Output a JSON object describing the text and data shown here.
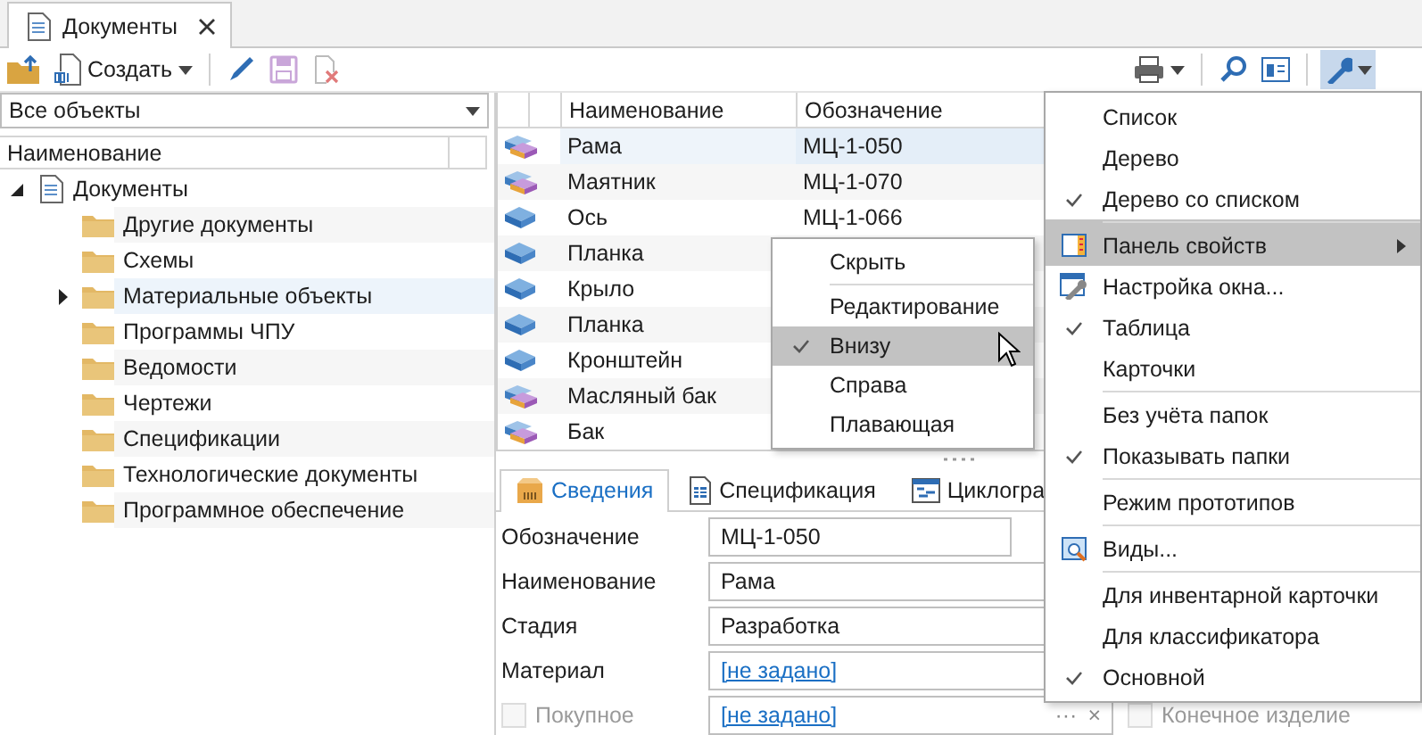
{
  "document_tab": {
    "title": "Документы",
    "selected": true
  },
  "toolbar": {
    "create_label": "Создать",
    "wrench_pressed": true
  },
  "filter": {
    "value": "Все объекты"
  },
  "tree": {
    "column": "Наименование",
    "items": [
      {
        "label": "Документы",
        "kind": "document",
        "expanded": true,
        "hovered": false,
        "children": [
          {
            "label": "Другие документы",
            "kind": "folder",
            "has_children": false,
            "hovered": false
          },
          {
            "label": "Схемы",
            "kind": "folder",
            "has_children": false,
            "hovered": false
          },
          {
            "label": "Материальные объекты",
            "kind": "folder",
            "has_children": true,
            "hovered": true
          },
          {
            "label": "Программы ЧПУ",
            "kind": "folder",
            "has_children": false,
            "hovered": false
          },
          {
            "label": "Ведомости",
            "kind": "folder",
            "has_children": false,
            "hovered": false
          },
          {
            "label": "Чертежи",
            "kind": "folder",
            "has_children": false,
            "hovered": false
          },
          {
            "label": "Спецификации",
            "kind": "folder",
            "has_children": false,
            "hovered": false
          },
          {
            "label": "Технологические документы",
            "kind": "folder",
            "has_children": false,
            "hovered": false
          },
          {
            "label": "Программное обеспечение",
            "kind": "folder",
            "has_children": false,
            "hovered": false
          }
        ]
      }
    ]
  },
  "table": {
    "columns": [
      "Наименование",
      "Обозначение"
    ],
    "rows": [
      {
        "kind": "assembly",
        "name": "Рама",
        "code": "МЦ-1-050",
        "selected": true
      },
      {
        "kind": "assembly",
        "name": "Маятник",
        "code": "МЦ-1-070",
        "selected": false
      },
      {
        "kind": "part",
        "name": "Ось",
        "code": "МЦ-1-066",
        "selected": false
      },
      {
        "kind": "part",
        "name": "Планка",
        "selected": false
      },
      {
        "kind": "part",
        "name": "Крыло",
        "selected": false
      },
      {
        "kind": "part",
        "name": "Планка",
        "selected": false
      },
      {
        "kind": "part",
        "name": "Кронштейн",
        "selected": false
      },
      {
        "kind": "assembly",
        "name": "Масляный бак",
        "selected": false
      },
      {
        "kind": "assembly",
        "name": "Бак",
        "selected": false
      }
    ]
  },
  "details": {
    "tabs": [
      {
        "label": "Сведения",
        "kind": "box",
        "selected": true
      },
      {
        "label": "Спецификация",
        "kind": "sheet",
        "selected": false
      },
      {
        "label": "Циклогра",
        "kind": "chart",
        "selected": false
      }
    ],
    "fields": [
      {
        "kind": "text",
        "label": "Обозначение",
        "value": "МЦ-1-050"
      },
      {
        "kind": "text",
        "label": "Наименование",
        "value": "Рама"
      },
      {
        "kind": "text",
        "label": "Стадия",
        "value": "Разработка"
      },
      {
        "kind": "link",
        "label": "Материал",
        "value": "[не задано]"
      },
      {
        "kind": "checkbox",
        "label": "Покупное",
        "checked": false,
        "disabled": true,
        "value": "[не задано]",
        "ellipsis": "···",
        "clear": "×",
        "extra": {
          "label": "Конечное изделие",
          "checked": false,
          "disabled": true
        }
      }
    ]
  },
  "view_menu": {
    "items": [
      {
        "label": "Список",
        "checked": false,
        "highlighted": false,
        "submenu": false,
        "separator_before": false
      },
      {
        "label": "Дерево",
        "checked": false,
        "highlighted": false,
        "submenu": false,
        "separator_before": false
      },
      {
        "label": "Дерево со списком",
        "checked": true,
        "highlighted": false,
        "submenu": false,
        "separator_before": false
      },
      {
        "label": "Панель свойств",
        "kind": "panel",
        "checked": false,
        "highlighted": true,
        "submenu": true,
        "separator_before": true
      },
      {
        "label": "Настройка окна...",
        "kind": "settings",
        "checked": false,
        "highlighted": false,
        "submenu": false,
        "separator_before": false
      },
      {
        "label": "Таблица",
        "checked": true,
        "highlighted": false,
        "submenu": false,
        "separator_before": false
      },
      {
        "label": "Карточки",
        "checked": false,
        "highlighted": false,
        "submenu": false,
        "separator_before": false
      },
      {
        "label": "Без учёта папок",
        "checked": false,
        "highlighted": false,
        "submenu": false,
        "separator_before": true
      },
      {
        "label": "Показывать папки",
        "checked": true,
        "highlighted": false,
        "submenu": false,
        "separator_before": false
      },
      {
        "label": "Режим прототипов",
        "checked": false,
        "highlighted": false,
        "submenu": false,
        "separator_before": true
      },
      {
        "label": "Виды...",
        "kind": "views",
        "checked": false,
        "highlighted": false,
        "submenu": false,
        "separator_before": true
      },
      {
        "label": "Для инвентарной карточки",
        "checked": false,
        "highlighted": false,
        "submenu": false,
        "separator_before": true
      },
      {
        "label": "Для классификатора",
        "checked": false,
        "highlighted": false,
        "submenu": false,
        "separator_before": false
      },
      {
        "label": "Основной",
        "checked": true,
        "highlighted": false,
        "submenu": false,
        "separator_before": false
      }
    ]
  },
  "panel_submenu": {
    "items": [
      {
        "label": "Скрыть",
        "checked": false,
        "highlighted": false,
        "separator_before": false
      },
      {
        "label": "Редактирование",
        "checked": false,
        "highlighted": false,
        "separator_before": true
      },
      {
        "label": "Внизу",
        "checked": true,
        "highlighted": true,
        "separator_before": false
      },
      {
        "label": "Справа",
        "checked": false,
        "highlighted": false,
        "separator_before": false
      },
      {
        "label": "Плавающая",
        "checked": false,
        "highlighted": false,
        "separator_before": false
      }
    ]
  }
}
